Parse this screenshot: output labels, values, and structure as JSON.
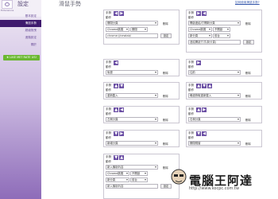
{
  "app": {
    "logo_text": "Extensions",
    "sidebar_title": "設定",
    "page_title": "滑鼠手勢",
    "help_link": "如何使用滑鼠手勢?"
  },
  "sidebar": {
    "items": [
      {
        "label": "基本設定",
        "active": false
      },
      {
        "label": "滑鼠手勢",
        "active": true
      },
      {
        "label": "超級拖曳",
        "active": false
      },
      {
        "label": "進階設定",
        "active": false
      },
      {
        "label": "關於",
        "active": false
      }
    ],
    "like_box": "★ LIKE ME? RATE US!"
  },
  "labels": {
    "gesture": "手勢",
    "action": "動作",
    "delete": "刪除"
  },
  "cards": [
    {
      "arrows": "◀▶",
      "action": "關閉分頁",
      "delete": "刪除"
    },
    {
      "arrows": "◀▶",
      "action": "開啟連結/打開新分頁",
      "delete": "刪除"
    },
    {
      "arrows": "◀▶",
      "action": "後退",
      "delete": "刪除"
    },
    {
      "arrows": "◀▶",
      "action": "往前",
      "delete": "刪除"
    },
    {
      "arrows": "◀▶",
      "action": "重新載入",
      "delete": "刪除"
    },
    {
      "arrows": "◀▶",
      "action": "略過快取重新載入",
      "delete": "刪除"
    },
    {
      "arrows": "◀▶",
      "action": "左側分頁",
      "delete": "刪除"
    },
    {
      "arrows": "◀▶",
      "action": "右側分頁",
      "delete": "刪除"
    },
    {
      "arrows": "◀▶",
      "action": "新增分頁",
      "delete": "刪除"
    },
    {
      "arrows": "◀▶",
      "action": "關閉視窗",
      "delete": "刪除"
    },
    {
      "arrows": "◀▶",
      "action": "新入機制內容",
      "delete": "刪除"
    }
  ],
  "extra": {
    "card0_row2_a": "Chrome擴展",
    "card0_row2_b": "關閉",
    "card0_input": "chrome://newtab/",
    "card0_btn": "設定",
    "card1_row2_a": "Chrome擴展",
    "card1_row2_b": "不開啟",
    "card1_row3_a": "新分頁",
    "card1_row3_b": "前台",
    "card1_row4": "連結開啟方式(新分頁)",
    "card1_btn": "設定",
    "last_row2_a": "Chrome擴展",
    "last_row2_b": "不開啟",
    "last_row3_a": "新分頁",
    "last_row3_b": "前台",
    "last_row4": "新入機制內容",
    "last_btn": "設定"
  },
  "watermark": {
    "text": "電腦王阿達",
    "url": "http://www.kocpc.com.tw"
  }
}
